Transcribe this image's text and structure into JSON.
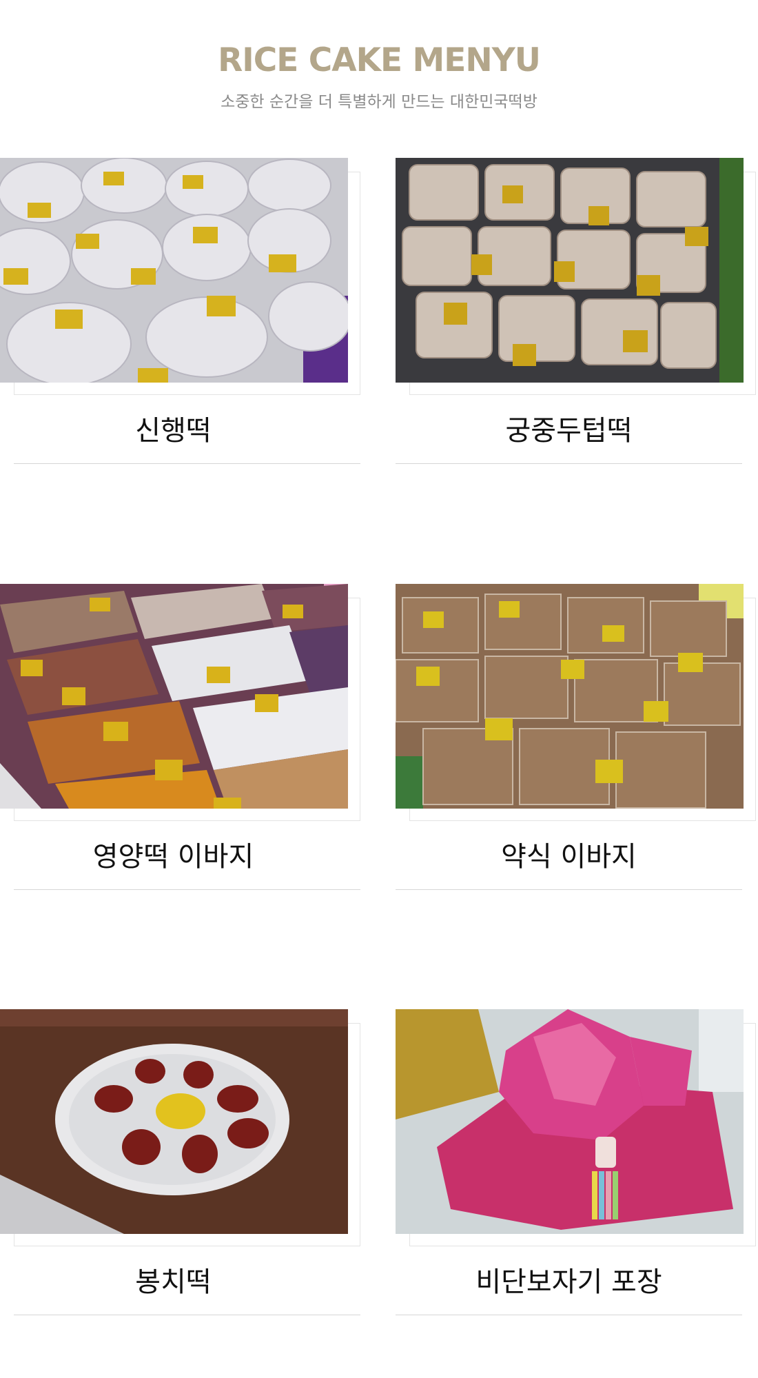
{
  "header": {
    "title": "RICE CAKE MENYU",
    "subtitle": "소중한 순간을 더 특별하게 만드는 대한민국떡방"
  },
  "menu": {
    "items": [
      {
        "label": "신행떡",
        "photo": "white-rice-cakes-photo"
      },
      {
        "label": "궁중두텁떡",
        "photo": "palace-dutup-rice-cakes-photo"
      },
      {
        "label": "영양떡 이바지",
        "photo": "nutritious-rice-cakes-photo"
      },
      {
        "label": "약식 이바지",
        "photo": "yaksik-photo"
      },
      {
        "label": "봉치떡",
        "photo": "bongchi-rice-cake-photo"
      },
      {
        "label": "비단보자기 포장",
        "photo": "silk-wrapping-photo"
      }
    ]
  },
  "colors": {
    "title": "#b3a68a",
    "subtitle": "#8a8a8a",
    "divider": "#d6d6d6"
  }
}
